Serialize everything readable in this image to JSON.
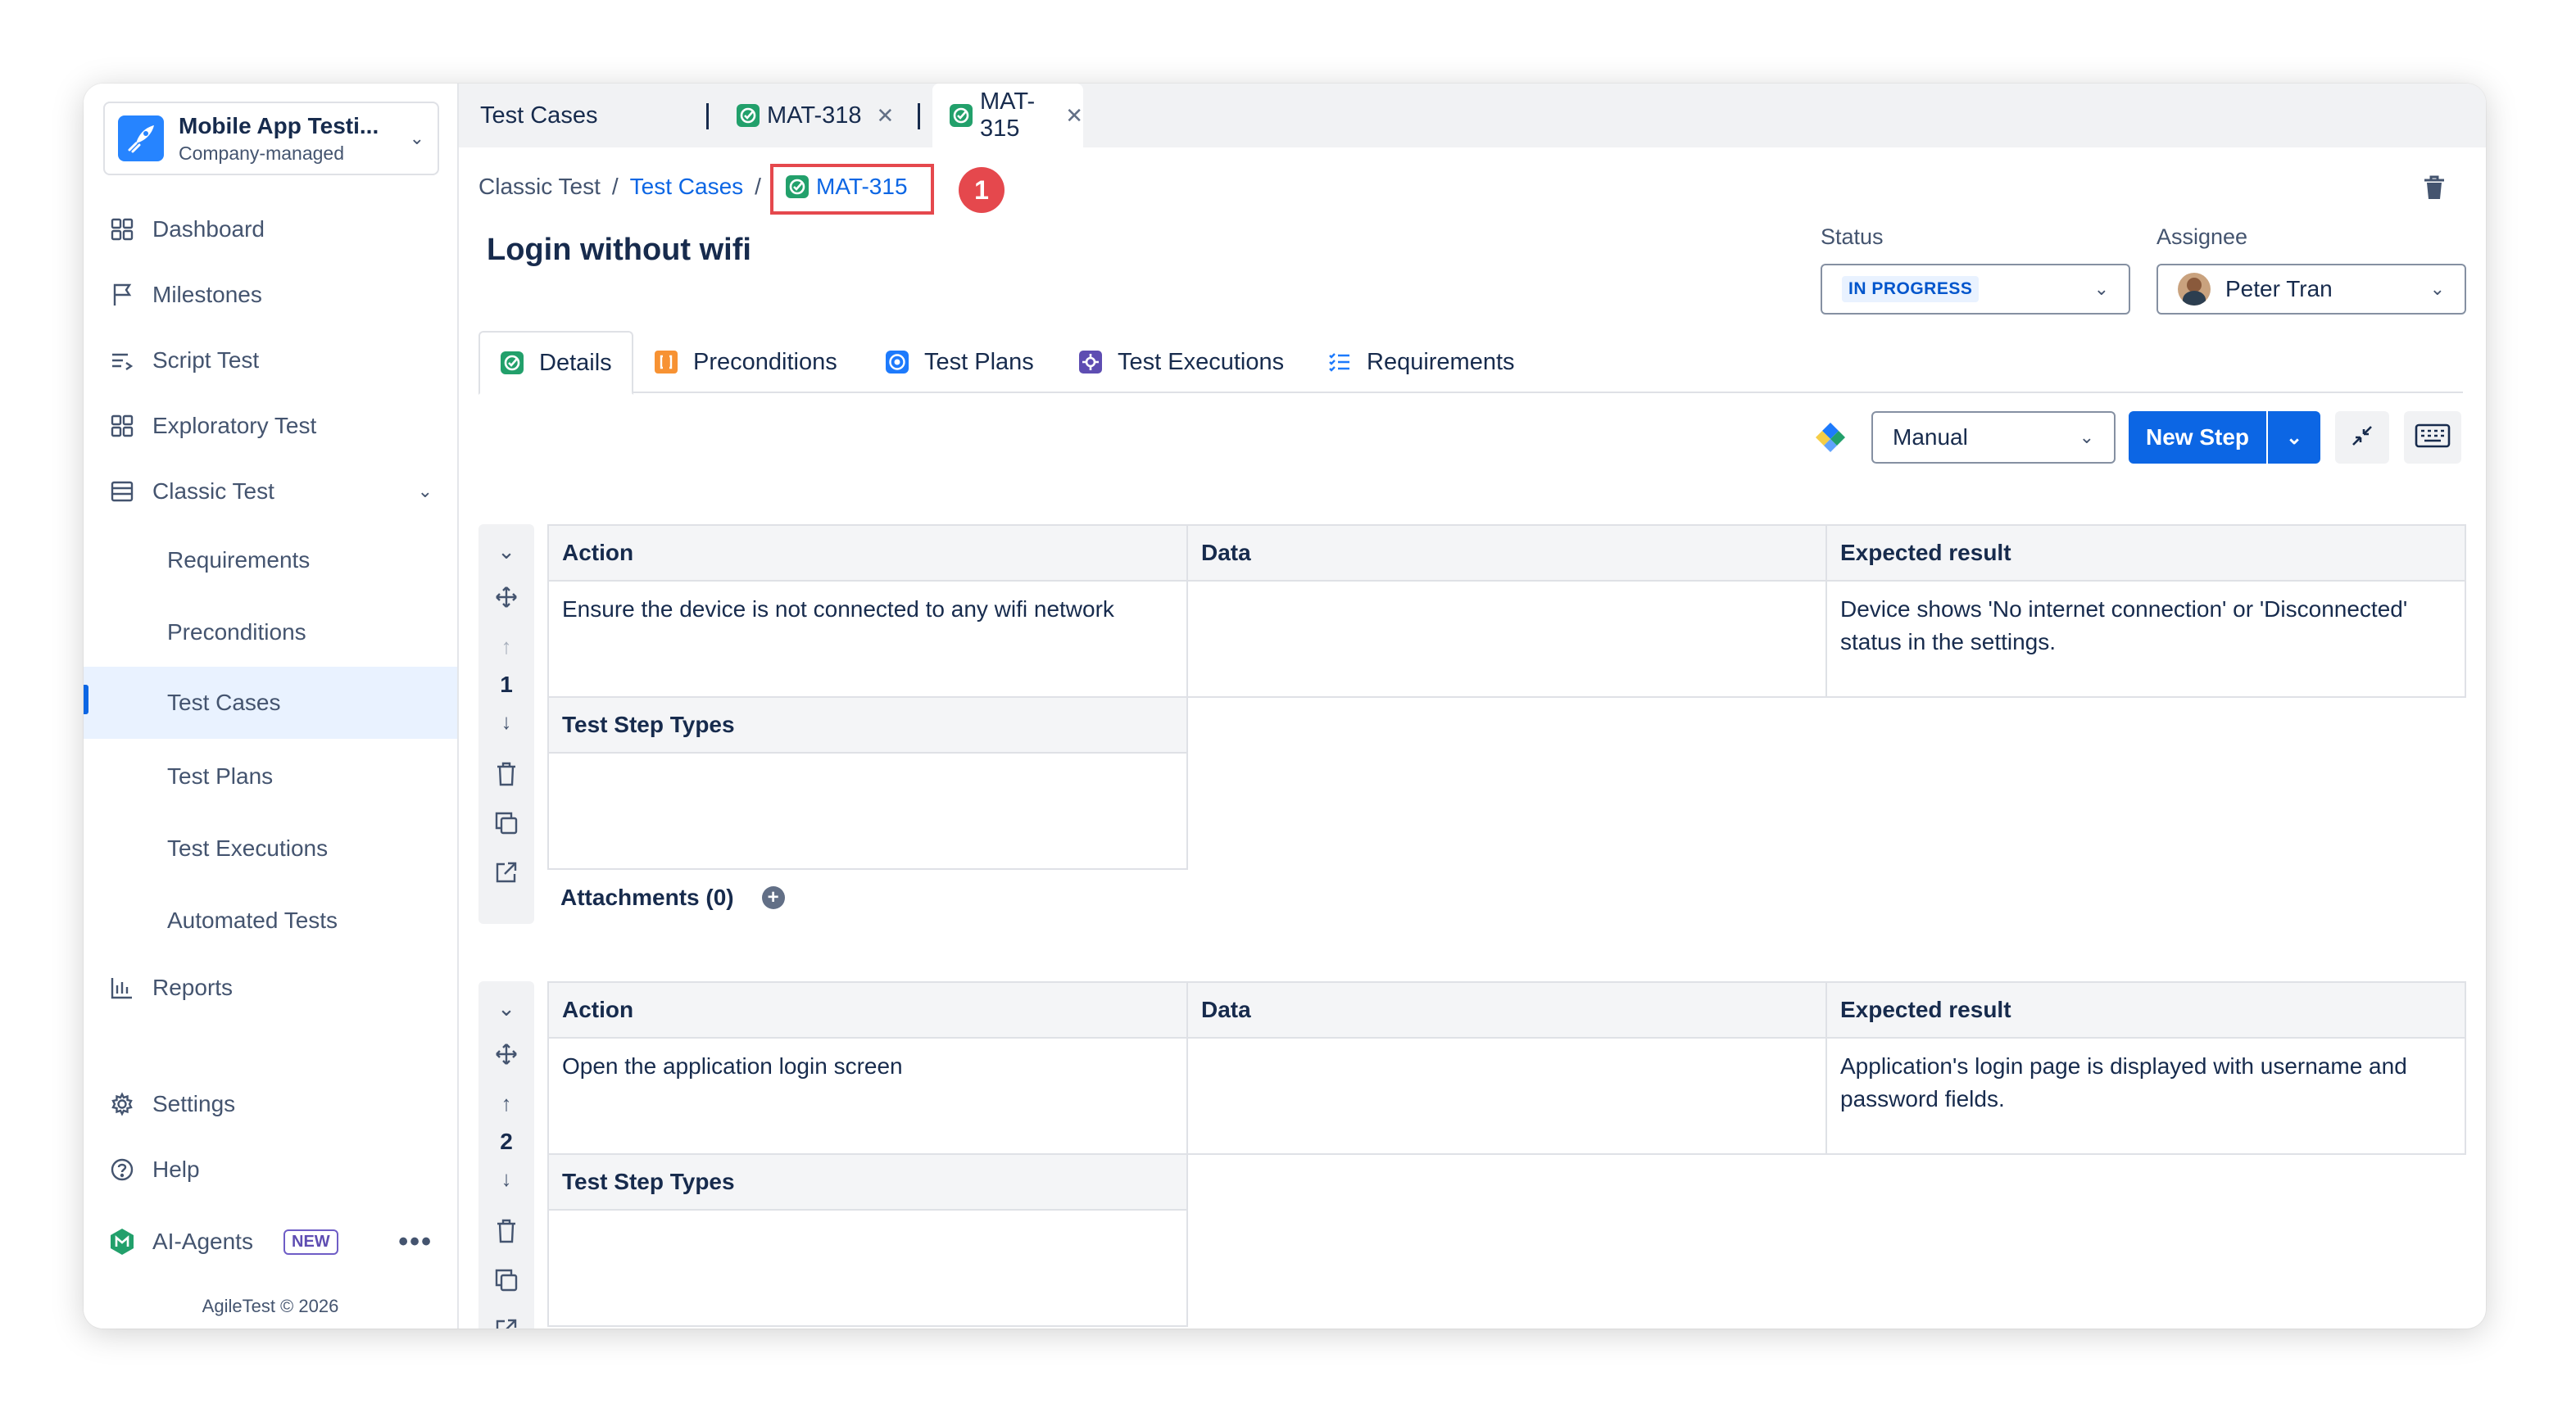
{
  "project": {
    "name": "Mobile App Testi...",
    "type": "Company-managed"
  },
  "nav": {
    "dashboard": "Dashboard",
    "milestones": "Milestones",
    "script_test": "Script Test",
    "exploratory_test": "Exploratory Test",
    "classic_test": "Classic Test",
    "requirements": "Requirements",
    "preconditions": "Preconditions",
    "test_cases": "Test Cases",
    "test_plans": "Test Plans",
    "test_executions": "Test Executions",
    "automated_tests": "Automated Tests",
    "reports": "Reports",
    "settings": "Settings",
    "help": "Help",
    "ai_agents": "AI-Agents",
    "ai_badge": "NEW",
    "footer": "AgileTest © 2026"
  },
  "tabs": [
    {
      "label": "Test Cases"
    },
    {
      "label": "MAT-318"
    },
    {
      "label": "MAT-315"
    }
  ],
  "breadcrumb": {
    "root": "Classic Test",
    "parent": "Test Cases",
    "current": "MAT-315",
    "marker": "1"
  },
  "issue": {
    "title": "Login without wifi",
    "status_label": "Status",
    "status_value": "IN PROGRESS",
    "assignee_label": "Assignee",
    "assignee_value": "Peter Tran"
  },
  "detail_tabs": [
    "Details",
    "Preconditions",
    "Test Plans",
    "Test Executions",
    "Requirements"
  ],
  "toolbar": {
    "mode": "Manual",
    "new_step": "New Step"
  },
  "table_headers": {
    "action": "Action",
    "data": "Data",
    "expected": "Expected result",
    "types": "Test Step Types"
  },
  "steps": [
    {
      "number": "1",
      "action": "Ensure the device is not connected to any wifi network",
      "data": "",
      "expected": "Device shows 'No internet connection' or 'Disconnected' status in the settings.",
      "attachments": "Attachments (0)"
    },
    {
      "number": "2",
      "action": "Open the application login screen",
      "data": "",
      "expected": "Application's login page is displayed with username and password fields."
    }
  ],
  "colors": {
    "accent": "#0c66e4",
    "marker": "#e5484d",
    "check_green": "#22a06b"
  }
}
